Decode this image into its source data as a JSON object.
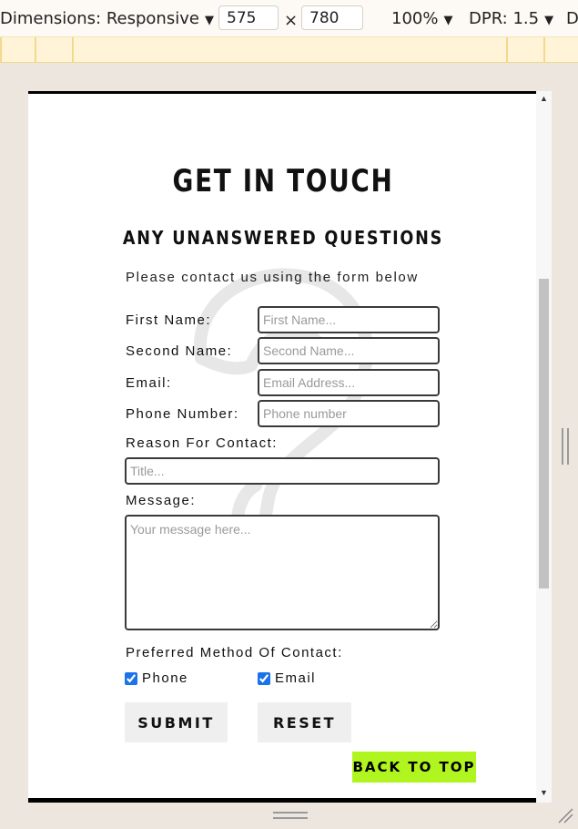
{
  "devtools": {
    "dimensions_label": "Dimensions: Responsive",
    "width": "575",
    "times": "×",
    "height": "780",
    "zoom": "100%",
    "dpr": "DPR: 1.5",
    "truncated": "D"
  },
  "page": {
    "title": "GET IN TOUCH",
    "subtitle": "ANY UNANSWERED QUESTIONS",
    "intro": "Please contact us using the form below",
    "form": {
      "first_name_label": "First Name:",
      "first_name_placeholder": "First Name...",
      "second_name_label": "Second Name:",
      "second_name_placeholder": "Second Name...",
      "email_label": "Email:",
      "email_placeholder": "Email Address...",
      "phone_label": "Phone Number:",
      "phone_placeholder": "Phone number",
      "reason_label": "Reason For Contact:",
      "reason_placeholder": "Title...",
      "message_label": "Message:",
      "message_placeholder": "Your message here...",
      "preferred_label": "Preferred Method Of Contact:",
      "phone_option": "Phone",
      "phone_checked": true,
      "email_option": "Email",
      "email_checked": true,
      "submit_label": "SUBMIT",
      "reset_label": "RESET"
    },
    "back_to_top_label": "BACK TO TOP"
  },
  "colors": {
    "accent": "#b1f520",
    "toolbar_bg": "#fdf9f4",
    "media_query_bar": "#fff4d8",
    "gutter": "#ede6df"
  },
  "icons": [
    "caret-down-icon",
    "resize-corner-icon",
    "drag-handle-icon",
    "question-mark-watermark-icon"
  ]
}
